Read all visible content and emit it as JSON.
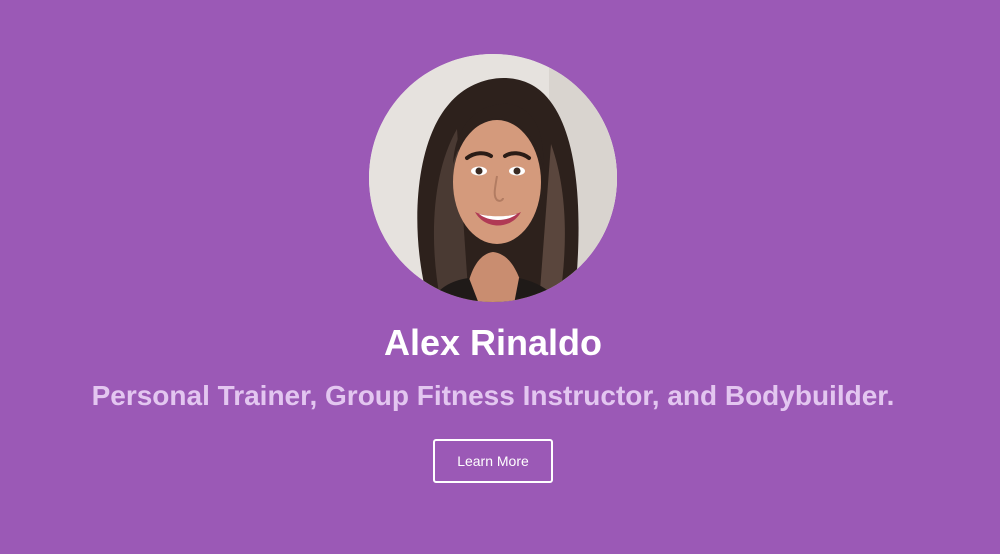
{
  "hero": {
    "avatar_icon": "profile-photo",
    "name": "Alex Rinaldo",
    "tagline": "Personal Trainer, Group Fitness Instructor, and Bodybuilder.",
    "cta_label": "Learn More"
  },
  "colors": {
    "background": "#9b59b6",
    "name_text": "#ffffff",
    "tagline_text": "#e3c6f0",
    "button_border": "#ffffff"
  }
}
